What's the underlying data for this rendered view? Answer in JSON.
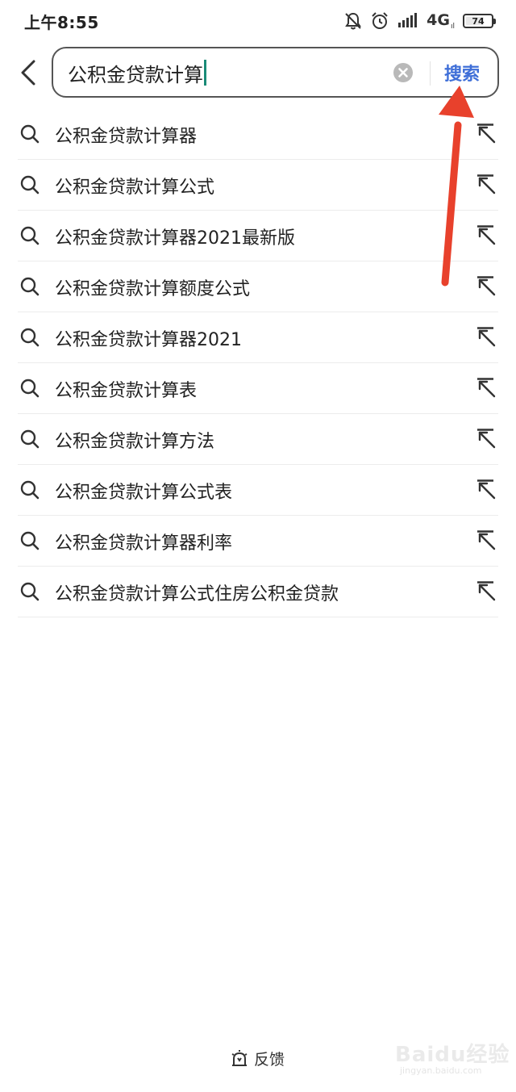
{
  "status_bar": {
    "time": "上午8:55",
    "network": "4G",
    "network_sub": "ıl",
    "battery": "74",
    "battery_level_percent": 74
  },
  "search": {
    "query": "公积金贷款计算",
    "search_button_label": "搜索"
  },
  "suggestions": [
    "公积金贷款计算器",
    "公积金贷款计算公式",
    "公积金贷款计算器2021最新版",
    "公积金贷款计算额度公式",
    "公积金贷款计算器2021",
    "公积金贷款计算表",
    "公积金贷款计算方法",
    "公积金贷款计算公式表",
    "公积金贷款计算器利率",
    "公积金贷款计算公式住房公积金贷款"
  ],
  "footer": {
    "feedback_label": "反馈"
  },
  "watermark": {
    "main": "Baidu经验",
    "sub": "jingyan.baidu.com"
  },
  "colors": {
    "accent": "#3f6fd8",
    "caret": "#1a8b77",
    "annotation": "#e8412c"
  },
  "icons": {
    "back": "chevron-left-icon",
    "clear": "clear-circle-icon",
    "suggestion": "search-icon",
    "fill_query": "arrow-up-left-icon",
    "feedback": "feedback-icon"
  }
}
